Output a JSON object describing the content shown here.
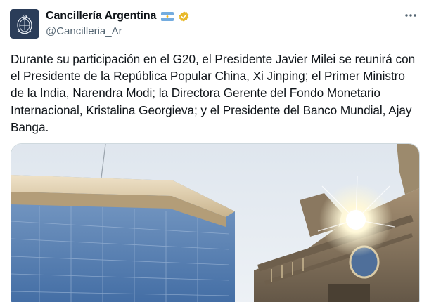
{
  "tweet": {
    "author": {
      "display_name": "Cancillería Argentina",
      "handle": "@Cancilleria_Ar",
      "avatar_icon": "coat-of-arms-icon",
      "flag_icon": "argentina-flag-icon",
      "verified_icon": "gold-verified-badge-icon"
    },
    "text": "Durante su participación en el G20, el Presidente Javier Milei se reunirá con el Presidente de la República Popular China, Xi Jinping; el Primer Ministro de la India, Narendra Modi; la Directora Gerente del Fondo Monetario Internacional, Kristalina Georgieva; y el Presidente del Banco Mundial, Ajay Banga.",
    "more_icon": "more-options-icon"
  },
  "colors": {
    "text_primary": "#0f1419",
    "text_secondary": "#536471",
    "verified_gold": "#e8b829",
    "avatar_bg": "#2b3d59"
  }
}
